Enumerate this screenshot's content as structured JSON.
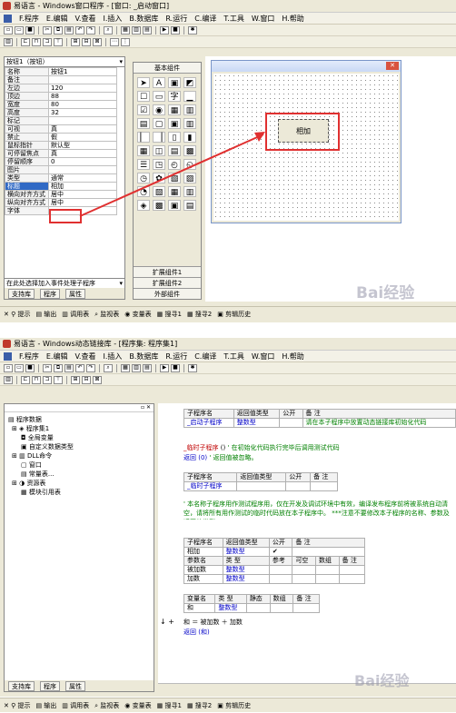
{
  "top": {
    "title": "易语言 - Windows窗口程序 - [窗口: _启动窗口]",
    "menu": [
      "F.程序",
      "E.编辑",
      "V.查看",
      "I.插入",
      "B.数据库",
      "R.运行",
      "C.编译",
      "T.工具",
      "W.窗口",
      "H.帮助"
    ],
    "props": {
      "combo": "按钮1（按钮）",
      "rows": [
        [
          "名称",
          "按钮1"
        ],
        [
          "备注",
          ""
        ],
        [
          "左边",
          "120"
        ],
        [
          "顶边",
          "88"
        ],
        [
          "宽度",
          "80"
        ],
        [
          "高度",
          "32"
        ],
        [
          "标记",
          ""
        ],
        [
          "可视",
          "真"
        ],
        [
          "禁止",
          "假"
        ],
        [
          "鼠标指针",
          "默认型"
        ],
        [
          "可停留焦点",
          "真"
        ],
        [
          "停留顺序",
          "0"
        ],
        [
          "图片",
          ""
        ],
        [
          "类型",
          "通常"
        ],
        [
          "标题",
          "相加"
        ],
        [
          "横向对齐方式",
          "居中"
        ],
        [
          "纵向对齐方式",
          "居中"
        ],
        [
          "字体",
          ""
        ]
      ],
      "event_combo": "在此处选择加入事件处理子程序"
    },
    "bottom_tabs": [
      "支持库",
      "程序",
      "属性"
    ],
    "components": {
      "header": "基本组件",
      "footer": [
        "扩展组件1",
        "扩展组件2",
        "外部组件"
      ]
    },
    "form_button": "相加",
    "watermark": "Bai经验"
  },
  "bottom": {
    "title": "易语言 - Windows动态链接库 - [程序集: 程序集1]",
    "menu": [
      "F.程序",
      "E.编辑",
      "V.查看",
      "I.插入",
      "B.数据库",
      "R.运行",
      "C.编译",
      "T.工具",
      "W.窗口",
      "H.帮助"
    ],
    "tree": [
      "程序数据",
      "程序集1",
      "全局变量",
      "自定义数据类型",
      "DLL命令",
      "窗口",
      "常量表...",
      "资源表",
      "模块引用表"
    ],
    "tabs": [
      "支持库",
      "程序",
      "属性"
    ],
    "table1": {
      "headers": [
        "子程序名",
        "返回值类型",
        "公开",
        "备 注"
      ],
      "row": [
        "_启动子程序",
        "整数型",
        "",
        "请在本子程序中放置动态链接库初始化代码"
      ]
    },
    "code1": {
      "line1_name": "_临时子程序",
      "line1_paren": " ()",
      "line1_comment": "' 在初始化代码执行完毕后调用测试代码",
      "line2": "返回 (0)",
      "line2_comment": "' 返回值被忽略。"
    },
    "table2": {
      "headers": [
        "子程序名",
        "返回值类型",
        "公开",
        "备 注"
      ],
      "row": [
        "_临时子程序",
        "",
        "",
        ""
      ]
    },
    "comment_line": "' 本名称子程序用作测试程序用，仅在开发及调试环境中有效，编译发布程序前将被系统自动清空，请将所有用作测试的临时代码放在本子程序中。 ***注意不要修改本子程序的名称、参数及返回值类型。",
    "table3": {
      "headers": [
        "子程序名",
        "返回值类型",
        "公开",
        "备 注"
      ],
      "row": [
        "相加",
        "整数型",
        "✔",
        ""
      ],
      "param_headers": [
        "参数名",
        "类 型",
        "参考",
        "可空",
        "数组",
        "备 注"
      ],
      "params": [
        [
          "被加数",
          "整数型"
        ],
        [
          "加数",
          "整数型"
        ]
      ]
    },
    "table4": {
      "headers": [
        "变量名",
        "类 型",
        "静态",
        "数组",
        "备 注"
      ],
      "row": [
        "和",
        "整数型",
        "",
        "",
        ""
      ]
    },
    "code2": {
      "line1": "和 ＝ 被加数 ＋ 加数",
      "line2": "返回 (和)"
    },
    "watermark": "Bai经验"
  },
  "statusbar": [
    "提示",
    "输出",
    "调用表",
    "监视表",
    "变量表",
    "搜寻1",
    "搜寻2",
    "剪辑历史"
  ]
}
